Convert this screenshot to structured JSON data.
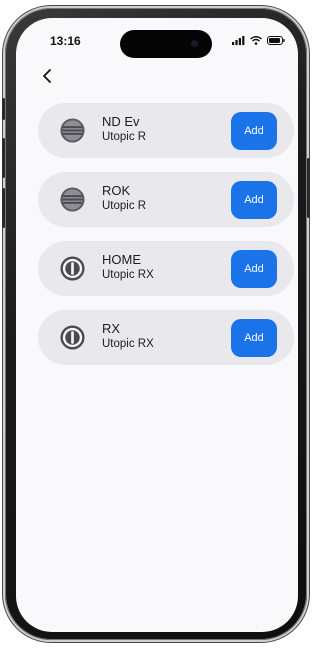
{
  "status_bar": {
    "time": "13:16",
    "icons": [
      "cellular-signal-icon",
      "wifi-icon",
      "battery-icon"
    ]
  },
  "nav": {
    "back_icon": "chevron-left-icon"
  },
  "devices": [
    {
      "name": "ND Ev",
      "model": "Utopic R",
      "icon": "lock-grill-icon",
      "add_label": "Add"
    },
    {
      "name": "ROK",
      "model": "Utopic R",
      "icon": "lock-grill-icon",
      "add_label": "Add"
    },
    {
      "name": "HOME",
      "model": "Utopic RX",
      "icon": "lock-ring-icon",
      "add_label": "Add"
    },
    {
      "name": "RX",
      "model": "Utopic RX",
      "icon": "lock-ring-icon",
      "add_label": "Add"
    }
  ],
  "colors": {
    "accent": "#1a73e8",
    "card": "#e8e8ed",
    "screen": "#f9f9fb"
  }
}
